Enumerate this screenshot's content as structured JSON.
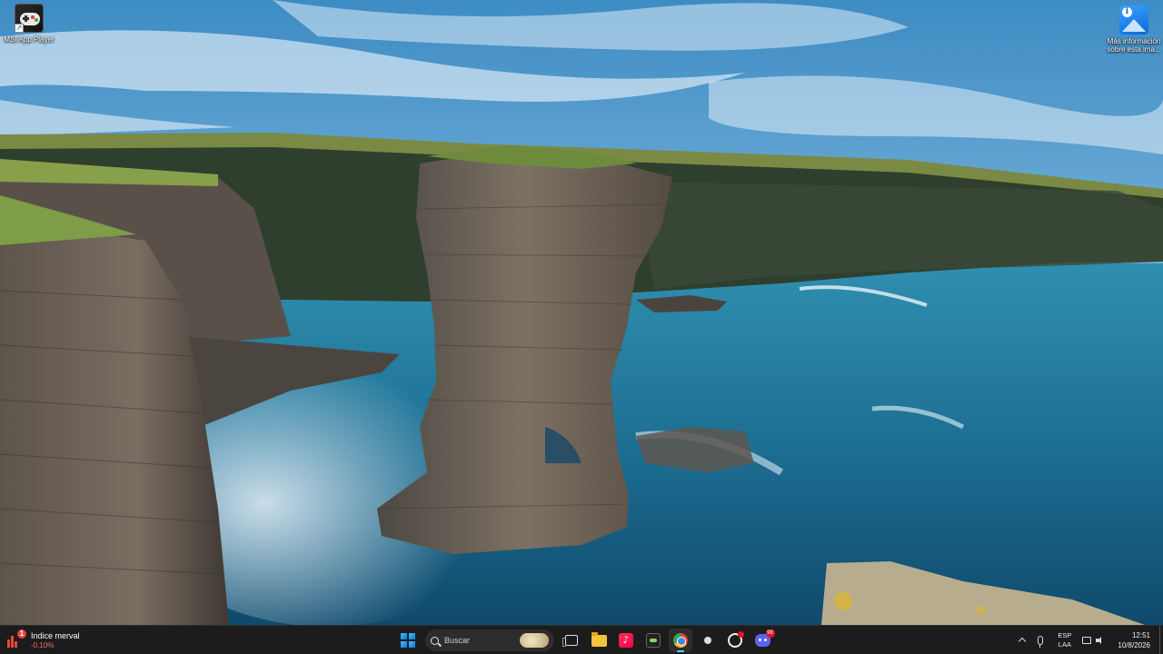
{
  "desktop": {
    "icons": [
      {
        "label": "MSI App Player",
        "icon": "gamepad-icon"
      },
      {
        "label": "Más información sobre esta ima...",
        "icon": "info-image-icon"
      }
    ]
  },
  "taskbar": {
    "widget": {
      "title": "Indice merval",
      "value": "-0,10%",
      "badge": "1",
      "color": "#e8453c"
    },
    "search": {
      "placeholder": "Buscar"
    },
    "apps": [
      {
        "name": "Start",
        "icon": "windows-icon"
      },
      {
        "name": "Task View",
        "icon": "task-view-icon"
      },
      {
        "name": "File Explorer",
        "icon": "folder-icon"
      },
      {
        "name": "TikTok",
        "icon": "tiktok-icon"
      },
      {
        "name": "MSI App Player",
        "icon": "msi-app-icon"
      },
      {
        "name": "Google Chrome",
        "icon": "chrome-icon",
        "active": true
      },
      {
        "name": "App",
        "icon": "dot-icon"
      },
      {
        "name": "App",
        "icon": "circle-icon"
      },
      {
        "name": "Discord",
        "icon": "discord-icon",
        "badge": "99"
      }
    ],
    "tray": {
      "language_top": "ESP",
      "language_bottom": "LAA",
      "time": "12:51",
      "date": "10/8/2026"
    }
  },
  "colors": {
    "taskbar_bg": "#1c1c1c",
    "accent": "#60cdff"
  }
}
